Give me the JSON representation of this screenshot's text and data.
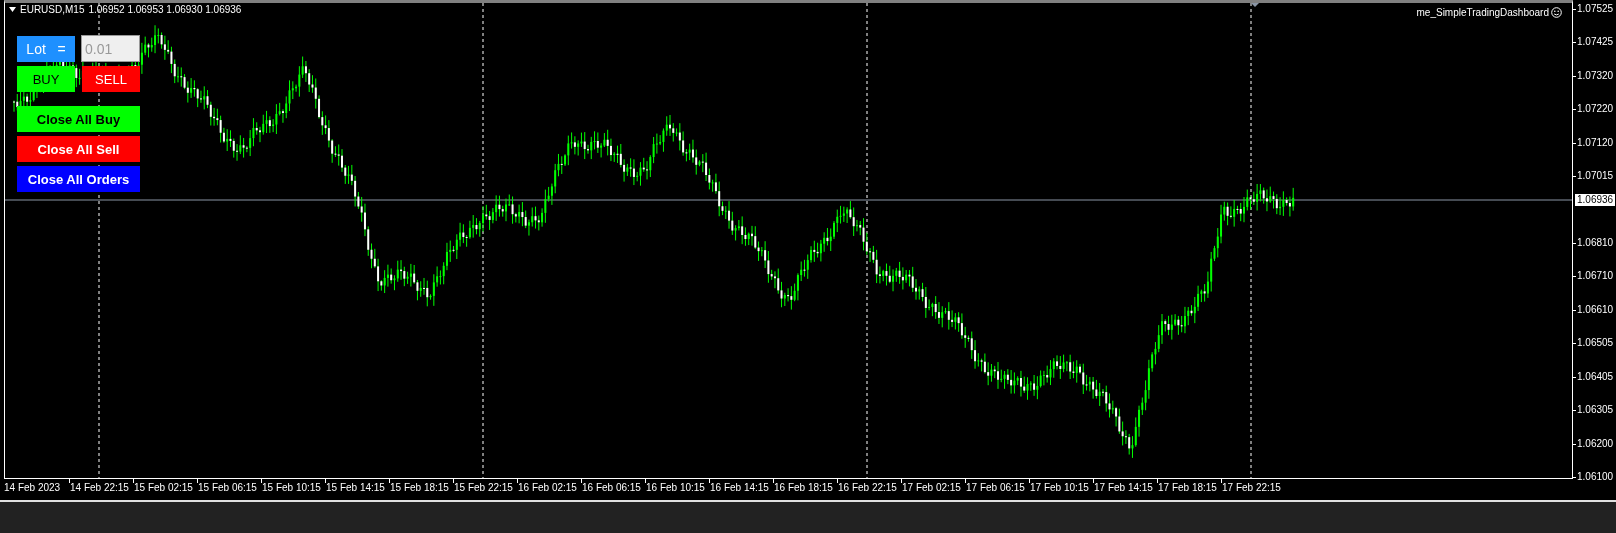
{
  "chart": {
    "symbol": "EURUSD,M15",
    "quotes": "1.06952 1.06953 1.06930 1.06936",
    "indicator": "me_SimpleTradingDashboard",
    "bid_label": "1.06936"
  },
  "price_axis": [
    "1.07525",
    "1.07425",
    "1.07320",
    "1.07220",
    "1.07120",
    "1.07015",
    "1.06810",
    "1.06710",
    "1.06610",
    "1.06505",
    "1.06405",
    "1.06305",
    "1.06200",
    "1.06100"
  ],
  "time_axis": [
    "14 Feb 2023",
    "14 Feb 22:15",
    "15 Feb 02:15",
    "15 Feb 06:15",
    "15 Feb 10:15",
    "15 Feb 14:15",
    "15 Feb 18:15",
    "15 Feb 22:15",
    "16 Feb 02:15",
    "16 Feb 06:15",
    "16 Feb 10:15",
    "16 Feb 14:15",
    "16 Feb 18:15",
    "16 Feb 22:15",
    "17 Feb 02:15",
    "17 Feb 06:15",
    "17 Feb 10:15",
    "17 Feb 14:15",
    "17 Feb 18:15",
    "17 Feb 22:15"
  ],
  "dashboard": {
    "lot_label": "Lot   =",
    "lot_value": "0.01",
    "buttons": [
      {
        "label": "BUY",
        "kind": "buy"
      },
      {
        "label": "SELL",
        "kind": "sell"
      },
      {
        "label": "Close All Buy",
        "kind": "buy"
      },
      {
        "label": "Close All Sell",
        "kind": "sell"
      },
      {
        "label": "Close All Orders",
        "kind": "orders"
      }
    ]
  }
}
